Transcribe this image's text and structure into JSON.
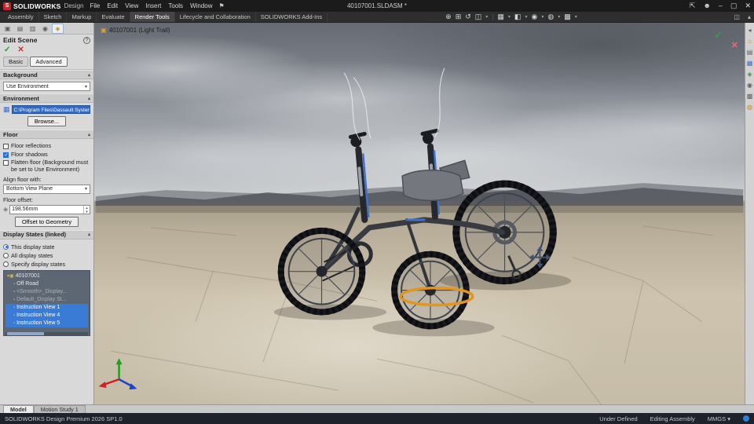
{
  "title_bar": {
    "app_name": "SOLIDWORKS",
    "app_edition": "Design",
    "menus": [
      "File",
      "Edit",
      "View",
      "Insert",
      "Tools",
      "Window"
    ],
    "document_title": "40107001.SLDASM *"
  },
  "ribbon": {
    "tabs": [
      "Assembly",
      "Sketch",
      "Markup",
      "Evaluate",
      "Render Tools",
      "Lifecycle and Collaboration",
      "SOLIDWORKS Add-Ins"
    ],
    "active_tab": "Render Tools"
  },
  "hud_toolbar": {
    "icons": [
      {
        "name": "zoom-fit-icon",
        "glyph": "⊕"
      },
      {
        "name": "zoom-area-icon",
        "glyph": "⊞"
      },
      {
        "name": "previous-view-icon",
        "glyph": "↺"
      },
      {
        "name": "section-view-icon",
        "glyph": "◫"
      },
      {
        "name": "view-orientation-icon",
        "glyph": "▦"
      },
      {
        "name": "display-style-icon",
        "glyph": "◧"
      },
      {
        "name": "hide-show-items-icon",
        "glyph": "◉"
      },
      {
        "name": "edit-appearance-icon",
        "glyph": "◍"
      },
      {
        "name": "view-settings-icon",
        "glyph": "▩"
      }
    ],
    "caret": "▾",
    "separator": "|"
  },
  "property_manager": {
    "title": "Edit Scene",
    "help_glyph": "?",
    "ok_glyph": "✓",
    "cancel_glyph": "✕",
    "mode_tabs": [
      "Basic",
      "Advanced"
    ],
    "active_mode_tab": "Advanced",
    "background": {
      "label": "Background",
      "value": "Use Environment"
    },
    "environment": {
      "label": "Environment",
      "path": "C:\\Program Files\\Dassault Systeme",
      "browse_label": "Browse..."
    },
    "floor": {
      "label": "Floor",
      "checkboxes": [
        {
          "label": "Floor reflections",
          "checked": false
        },
        {
          "label": "Floor shadows",
          "checked": true
        },
        {
          "label": "Flatten floor (Background must be set to Use Environment)",
          "checked": false
        }
      ],
      "align_label": "Align floor with:",
      "align_value": "Bottom View Plane",
      "offset_label": "Floor offset:",
      "offset_value": "198.56mm",
      "offset_button": "Offset to Geometry"
    },
    "display_states": {
      "label": "Display States (linked)",
      "options": [
        {
          "label": "This display state",
          "selected": true
        },
        {
          "label": "All display states",
          "selected": false
        },
        {
          "label": "Specify display states",
          "selected": false
        }
      ],
      "tree": [
        {
          "label": "40107001"
        },
        {
          "label": "Off Road"
        },
        {
          "label": "<Smooth>_Display..."
        },
        {
          "label": "Default_Display St..."
        },
        {
          "label": "Instruction View 1"
        },
        {
          "label": "Instruction View 4"
        },
        {
          "label": "Instruction View 5"
        }
      ]
    }
  },
  "viewport": {
    "breadcrumb": "40107001 (Light Trail)",
    "confirm_ok": "✓",
    "confirm_cancel": "✕",
    "manipulator_color": "#e2951f"
  },
  "task_pane_icons": [
    {
      "name": "collapse-arrow-icon",
      "glyph": "◂"
    },
    {
      "name": "home-icon",
      "glyph": "⌂"
    },
    {
      "name": "design-library-icon",
      "glyph": "▤"
    },
    {
      "name": "file-explorer-icon",
      "glyph": "▦"
    },
    {
      "name": "view-palette-icon",
      "glyph": "◈"
    },
    {
      "name": "appearances-icon",
      "glyph": "◉"
    },
    {
      "name": "custom-properties-icon",
      "glyph": "▩"
    },
    {
      "name": "forum-icon",
      "glyph": "◍"
    }
  ],
  "pm_manager_tabs": [
    {
      "name": "feature-manager-tab",
      "glyph": "▣"
    },
    {
      "name": "property-manager-tab",
      "glyph": "▤"
    },
    {
      "name": "configuration-manager-tab",
      "glyph": "▥"
    },
    {
      "name": "dimxpert-manager-tab",
      "glyph": "◉"
    },
    {
      "name": "display-manager-tab",
      "glyph": "◈"
    }
  ],
  "doc_tabs": [
    "Model",
    "Motion Study 1"
  ],
  "status_bar": {
    "left_text": "SOLIDWORKS Design Premium 2026 SP1.0",
    "constraint_status": "Under Defined",
    "mode": "Editing Assembly",
    "units": "MMGS",
    "units_caret": "▾"
  },
  "window_icons": {
    "pin": "⚑",
    "signin": "⇱",
    "user": "☻",
    "minimize": "–",
    "maximize": "▢",
    "close": "✕"
  }
}
